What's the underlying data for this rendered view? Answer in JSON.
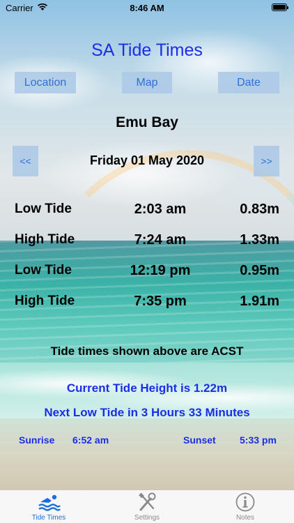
{
  "status_bar": {
    "carrier": "Carrier",
    "time": "8:46 AM"
  },
  "app": {
    "title": "SA Tide Times"
  },
  "toolbar": {
    "location_label": "Location",
    "map_label": "Map",
    "date_label": "Date"
  },
  "location": {
    "name": "Emu Bay"
  },
  "date_nav": {
    "prev_label": "<<",
    "next_label": ">>",
    "date": "Friday 01 May 2020"
  },
  "tides": [
    {
      "type": "Low Tide",
      "time": "2:03 am",
      "height": "0.83m"
    },
    {
      "type": "High Tide",
      "time": "7:24 am",
      "height": "1.33m"
    },
    {
      "type": "Low Tide",
      "time": "12:19 pm",
      "height": "0.95m"
    },
    {
      "type": "High Tide",
      "time": "7:35 pm",
      "height": "1.91m"
    }
  ],
  "info": {
    "timezone_note": "Tide times shown above are ACST",
    "current_height": "Current Tide Height is 1.22m",
    "next_low": "Next Low Tide in 3 Hours 33 Minutes"
  },
  "sun": {
    "sunrise_label": "Sunrise",
    "sunrise_time": "6:52 am",
    "sunset_label": "Sunset",
    "sunset_time": "5:33 pm"
  },
  "tabbar": {
    "tabs": [
      {
        "label": "Tide Times",
        "icon": "swimmer-icon",
        "selected": true
      },
      {
        "label": "Settings",
        "icon": "tools-icon",
        "selected": false
      },
      {
        "label": "Notes",
        "icon": "info-icon",
        "selected": false
      }
    ]
  },
  "colors": {
    "accent_blue": "#1a2ee6",
    "button_text": "#2f6fd6",
    "tab_selected": "#1a6fdc",
    "tab_unselected": "#8a8a8a"
  }
}
